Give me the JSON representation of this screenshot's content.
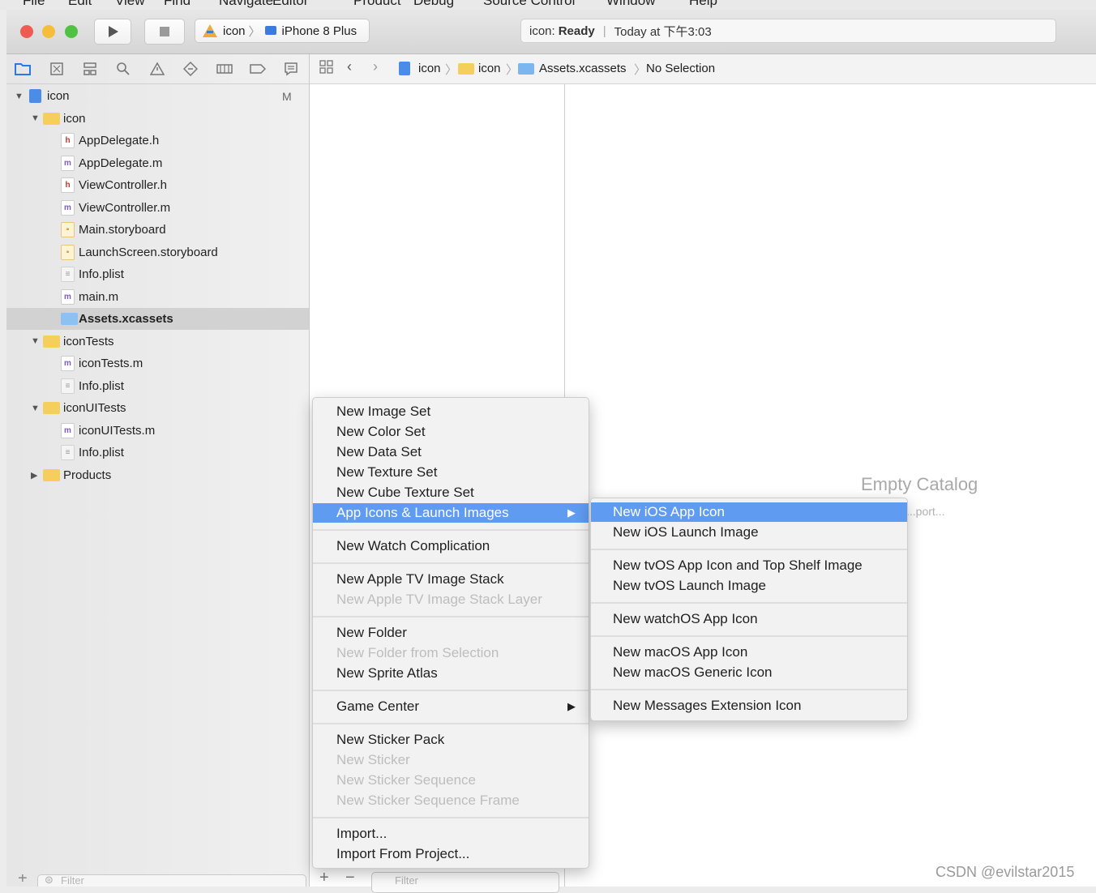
{
  "menubar": {
    "items": [
      "File",
      "Edit",
      "View",
      "Find",
      "Navigate",
      "Editor",
      "Product",
      "Debug",
      "Source Control",
      "Window",
      "Help"
    ]
  },
  "toolbar": {
    "scheme_project": "icon",
    "scheme_device": "iPhone 8 Plus",
    "activity_project": "icon:",
    "activity_status": "Ready",
    "activity_time": "Today at 下午3:03"
  },
  "navigator": {
    "tree": [
      {
        "label": "icon",
        "kind": "project",
        "badge": "M",
        "depth": 0,
        "expanded": true
      },
      {
        "label": "icon",
        "kind": "folder",
        "depth": 1,
        "expanded": true
      },
      {
        "label": "AppDelegate.h",
        "kind": "h",
        "depth": 2
      },
      {
        "label": "AppDelegate.m",
        "kind": "m",
        "depth": 2
      },
      {
        "label": "ViewController.h",
        "kind": "h",
        "depth": 2
      },
      {
        "label": "ViewController.m",
        "kind": "m",
        "depth": 2
      },
      {
        "label": "Main.storyboard",
        "kind": "storyboard",
        "depth": 2
      },
      {
        "label": "LaunchScreen.storyboard",
        "kind": "storyboard",
        "depth": 2
      },
      {
        "label": "Info.plist",
        "kind": "plist",
        "depth": 2
      },
      {
        "label": "main.m",
        "kind": "m",
        "depth": 2
      },
      {
        "label": "Assets.xcassets",
        "kind": "assets",
        "depth": 2,
        "selected": true
      },
      {
        "label": "iconTests",
        "kind": "folder",
        "depth": 1,
        "expanded": true
      },
      {
        "label": "iconTests.m",
        "kind": "m",
        "depth": 2
      },
      {
        "label": "Info.plist",
        "kind": "plist",
        "depth": 2
      },
      {
        "label": "iconUITests",
        "kind": "folder",
        "depth": 1,
        "expanded": true
      },
      {
        "label": "iconUITests.m",
        "kind": "m",
        "depth": 2
      },
      {
        "label": "Info.plist",
        "kind": "plist",
        "depth": 2
      },
      {
        "label": "Products",
        "kind": "folder",
        "depth": 1,
        "expanded": false
      }
    ],
    "filter_placeholder": "Filter"
  },
  "jumpbar": {
    "crumbs": [
      "icon",
      "icon",
      "Assets.xcassets",
      "No Selection"
    ]
  },
  "editor": {
    "empty_title": "Empty Catalog",
    "empty_sub": "...port...",
    "filter_placeholder": "Filter"
  },
  "context_menu": {
    "items": [
      {
        "label": "New Image Set"
      },
      {
        "label": "New Color Set"
      },
      {
        "label": "New Data Set"
      },
      {
        "label": "New Texture Set"
      },
      {
        "label": "New Cube Texture Set"
      },
      {
        "label": "App Icons & Launch Images",
        "submenu": true,
        "highlighted": true
      },
      {
        "sep": true
      },
      {
        "label": "New Watch Complication"
      },
      {
        "sep": true
      },
      {
        "label": "New Apple TV Image Stack"
      },
      {
        "label": "New Apple TV Image Stack Layer",
        "disabled": true
      },
      {
        "sep": true
      },
      {
        "label": "New Folder"
      },
      {
        "label": "New Folder from Selection",
        "disabled": true
      },
      {
        "label": "New Sprite Atlas"
      },
      {
        "sep": true
      },
      {
        "label": "Game Center",
        "submenu": true
      },
      {
        "sep": true
      },
      {
        "label": "New Sticker Pack"
      },
      {
        "label": "New Sticker",
        "disabled": true
      },
      {
        "label": "New Sticker Sequence",
        "disabled": true
      },
      {
        "label": "New Sticker Sequence Frame",
        "disabled": true
      },
      {
        "sep": true
      },
      {
        "label": "Import..."
      },
      {
        "label": "Import From Project..."
      }
    ]
  },
  "submenu": {
    "items": [
      {
        "label": "New iOS App Icon",
        "highlighted": true
      },
      {
        "label": "New iOS Launch Image"
      },
      {
        "sep": true
      },
      {
        "label": "New tvOS App Icon and Top Shelf Image"
      },
      {
        "label": "New tvOS Launch Image"
      },
      {
        "sep": true
      },
      {
        "label": "New watchOS App Icon"
      },
      {
        "sep": true
      },
      {
        "label": "New macOS App Icon"
      },
      {
        "label": "New macOS Generic Icon"
      },
      {
        "sep": true
      },
      {
        "label": "New Messages Extension Icon"
      }
    ]
  },
  "watermark": "CSDN @evilstar2015",
  "colors": {
    "highlight": "#5f9bf0",
    "folder": "#f4cf5c",
    "selection": "#d2d2d2"
  }
}
